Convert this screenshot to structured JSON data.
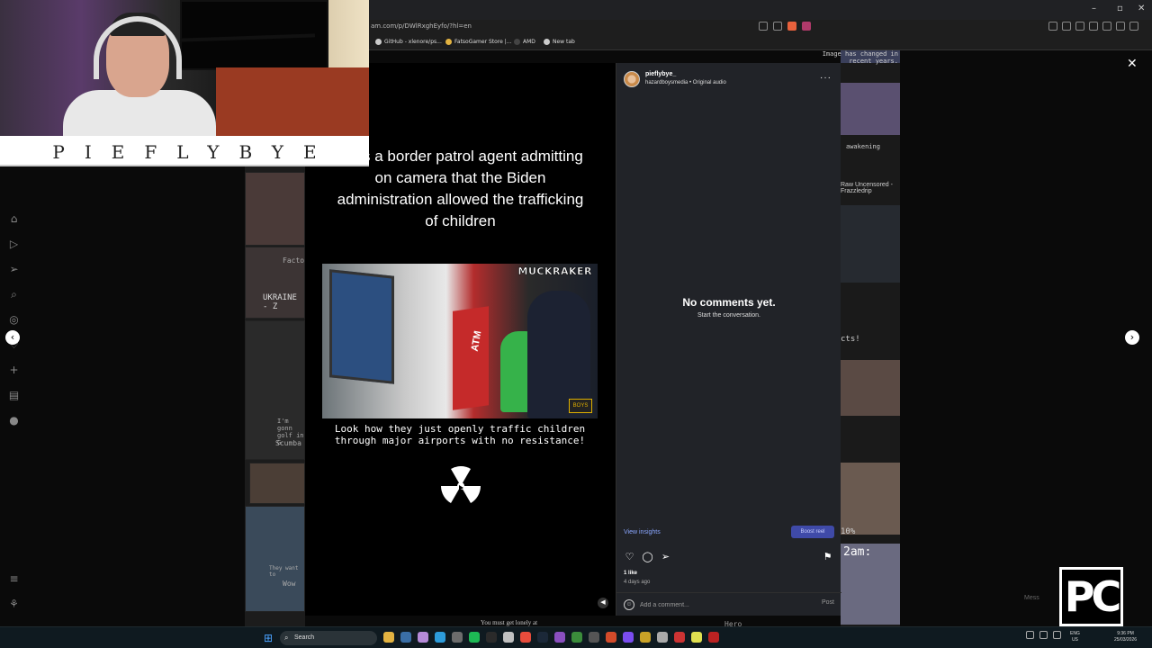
{
  "browser": {
    "url": "am.com/p/DWlRxghEyfo/?hl=en",
    "window_controls": [
      "–",
      "▫",
      "✕"
    ],
    "bookmarks": [
      {
        "label": "GitHub - xlenore/ps...",
        "icon": "github-icon"
      },
      {
        "label": "FatsoGamer Store |...",
        "icon": "store-icon"
      },
      {
        "label": "AMD",
        "icon": "amd-icon"
      },
      {
        "label": "New tab",
        "icon": "globe-icon"
      }
    ]
  },
  "webcam": {
    "nameplate": "PIEFLYBYE"
  },
  "background_feed": {
    "left_captions": [
      "Facto",
      "UKRAINE - Z",
      "I'm gonn golf in G",
      "Scumba",
      "They want to",
      "Wow"
    ],
    "right_captions": [
      "Image has changed in recent years.",
      "awakening",
      "Raw Uncensored - Frazzledrip",
      "cts!",
      "10%",
      "2am:",
      "Hero",
      "You must get lonely at"
    ]
  },
  "reel": {
    "caption": "ere's a border patrol agent admitting on camera that the Biden administration allowed the trafficking of children",
    "watermark": "MUCKRAKER",
    "atm_label": "ATM",
    "badge": "BOYS",
    "subtitle": "Look how they just openly traffic children through major airports with no resistance!"
  },
  "panel": {
    "username": "pieflybye_",
    "subline": "hazardboysmedia • Original audio",
    "empty_title": "No comments yet.",
    "empty_sub": "Start the conversation.",
    "view_insights": "View insights",
    "boost_label": "Boost reel",
    "likes": "1 like",
    "time_ago": "4 days ago",
    "comment_placeholder": "Add a comment...",
    "post_label": "Post"
  },
  "overlay": {
    "pc_logo": "PC",
    "message_hint": "Mess"
  },
  "taskbar": {
    "search_label": "Search",
    "language": "ENG",
    "region": "US",
    "time": "9:36 PM",
    "date": "25/03/2026",
    "app_colors": [
      "#e3b341",
      "#3a6ea5",
      "#b58ad8",
      "#2d9cdb",
      "#6c6c6c",
      "#1db954",
      "#2a2a2a",
      "#c0c0c0",
      "#e74c3c",
      "#1b2838",
      "#8a4fbf",
      "#3b8d3b",
      "#555",
      "#d34b2a",
      "#7a4df0",
      "#c9a227",
      "#aaa",
      "#cc3333",
      "#e0e050",
      "#bb2222"
    ]
  }
}
